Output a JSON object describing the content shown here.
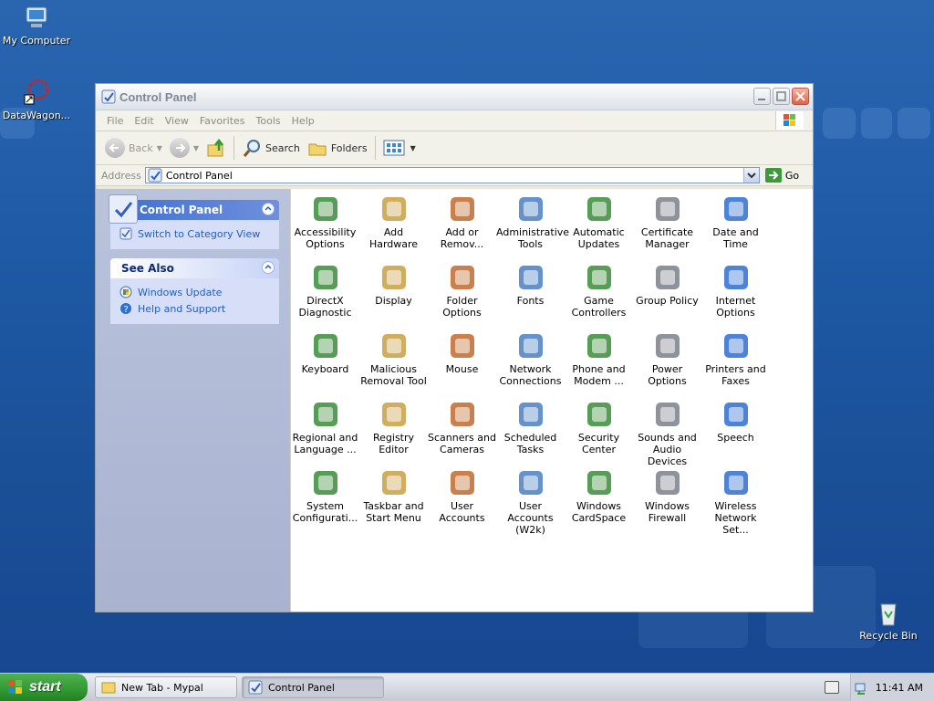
{
  "desktop": {
    "icons": [
      {
        "label": "My Computer"
      },
      {
        "label": "DataWagon..."
      },
      {
        "label": "Recycle Bin"
      }
    ]
  },
  "window": {
    "title": "Control Panel",
    "menu": [
      "File",
      "Edit",
      "View",
      "Favorites",
      "Tools",
      "Help"
    ],
    "toolbar": {
      "back": "Back",
      "search": "Search",
      "folders": "Folders"
    },
    "address": {
      "label": "Address",
      "value": "Control Panel",
      "go": "Go"
    },
    "left_pane": {
      "control_panel": {
        "title": "Control Panel",
        "switch_view": "Switch to Category View"
      },
      "see_also": {
        "title": "See Also",
        "items": [
          "Windows Update",
          "Help and Support"
        ]
      }
    },
    "items": [
      {
        "label": "Accessibility Options",
        "icon": "accessibility-icon"
      },
      {
        "label": "Add Hardware",
        "icon": "add-hardware-icon"
      },
      {
        "label": "Add or Remov...",
        "icon": "add-remove-programs-icon"
      },
      {
        "label": "Administrative Tools",
        "icon": "admin-tools-icon"
      },
      {
        "label": "Automatic Updates",
        "icon": "automatic-updates-icon"
      },
      {
        "label": "Certificate Manager",
        "icon": "certificate-icon"
      },
      {
        "label": "Date and Time",
        "icon": "date-time-icon"
      },
      {
        "label": "DirectX Diagnostic",
        "icon": "directx-icon"
      },
      {
        "label": "Display",
        "icon": "display-icon"
      },
      {
        "label": "Folder Options",
        "icon": "folder-options-icon"
      },
      {
        "label": "Fonts",
        "icon": "fonts-icon"
      },
      {
        "label": "Game Controllers",
        "icon": "game-controller-icon"
      },
      {
        "label": "Group Policy",
        "icon": "group-policy-icon"
      },
      {
        "label": "Internet Options",
        "icon": "internet-options-icon"
      },
      {
        "label": "Keyboard",
        "icon": "keyboard-icon"
      },
      {
        "label": "Malicious Removal Tool",
        "icon": "malicious-removal-icon"
      },
      {
        "label": "Mouse",
        "icon": "mouse-icon"
      },
      {
        "label": "Network Connections",
        "icon": "network-icon"
      },
      {
        "label": "Phone and Modem ...",
        "icon": "phone-modem-icon"
      },
      {
        "label": "Power Options",
        "icon": "power-icon"
      },
      {
        "label": "Printers and Faxes",
        "icon": "printer-icon"
      },
      {
        "label": "Regional and Language ...",
        "icon": "regional-icon"
      },
      {
        "label": "Registry Editor",
        "icon": "registry-icon"
      },
      {
        "label": "Scanners and Cameras",
        "icon": "scanner-icon"
      },
      {
        "label": "Scheduled Tasks",
        "icon": "scheduled-tasks-icon"
      },
      {
        "label": "Security Center",
        "icon": "security-center-icon"
      },
      {
        "label": "Sounds and Audio Devices",
        "icon": "sound-icon"
      },
      {
        "label": "Speech",
        "icon": "speech-icon"
      },
      {
        "label": "System Configurati...",
        "icon": "system-config-icon"
      },
      {
        "label": "Taskbar and Start Menu",
        "icon": "taskbar-icon"
      },
      {
        "label": "User Accounts",
        "icon": "user-accounts-icon"
      },
      {
        "label": "User Accounts (W2k)",
        "icon": "user-accounts-w2k-icon"
      },
      {
        "label": "Windows CardSpace",
        "icon": "cardspace-icon"
      },
      {
        "label": "Windows Firewall",
        "icon": "firewall-icon"
      },
      {
        "label": "Wireless Network Set...",
        "icon": "wireless-icon"
      }
    ]
  },
  "taskbar": {
    "start": "start",
    "tasks": [
      "New Tab - Mypal",
      "Control Panel"
    ],
    "clock": "11:41 AM"
  },
  "colors": {
    "desktop": "#1e5aa6",
    "left_pane": "#b9c3dc",
    "panel_link": "#215dc6",
    "start_green": "#329a32"
  }
}
